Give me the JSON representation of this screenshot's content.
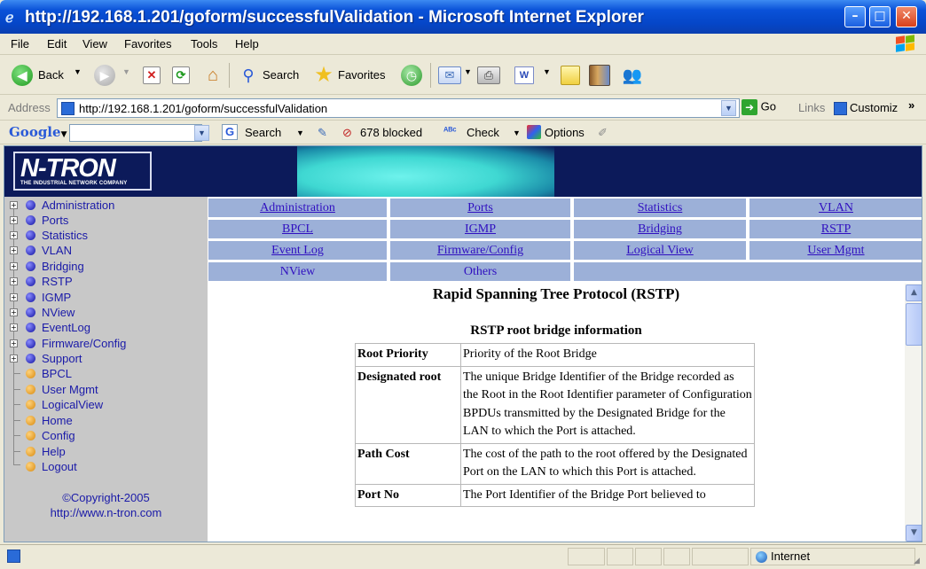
{
  "window": {
    "title": "http://192.168.1.201/goform/successfulValidation - Microsoft Internet Explorer"
  },
  "menu": [
    "File",
    "Edit",
    "View",
    "Favorites",
    "Tools",
    "Help"
  ],
  "toolbar": {
    "back_label": "Back",
    "search_label": "Search",
    "favorites_label": "Favorites"
  },
  "address": {
    "label": "Address",
    "url": "http://192.168.1.201/goform/successfulValidation",
    "go_label": "Go",
    "links_label": "Links",
    "customize_label": "Customiz"
  },
  "google_bar": {
    "logo": "Google",
    "search_label": "Search",
    "blocked_label": "678 blocked",
    "check_label": "Check",
    "options_label": "Options"
  },
  "banner": {
    "logo_text": "N-TRON",
    "logo_tagline": "THE INDUSTRIAL NETWORK COMPANY"
  },
  "left_nav": {
    "folders": [
      "Administration",
      "Ports",
      "Statistics",
      "VLAN",
      "Bridging",
      "RSTP",
      "IGMP",
      "NView",
      "EventLog",
      "Firmware/Config",
      "Support"
    ],
    "pages": [
      "BPCL",
      "User Mgmt",
      "LogicalView",
      "Home",
      "Config",
      "Help",
      "Logout"
    ],
    "copyright": "©Copyright-2005",
    "website": "http://www.n-tron.com"
  },
  "top_nav": {
    "row1": [
      "Administration",
      "Ports",
      "Statistics",
      "VLAN"
    ],
    "row2": [
      "BPCL",
      "IGMP",
      "Bridging",
      "RSTP"
    ],
    "row3": [
      "Event Log",
      "Firmware/Config",
      "Logical View",
      "User Mgmt"
    ],
    "row4": [
      "NView",
      "Others"
    ]
  },
  "main": {
    "page_title": "Rapid Spanning Tree Protocol (RSTP)",
    "section_title": "RSTP root bridge information",
    "rows": [
      {
        "key": "Root Priority",
        "value": "Priority of the Root Bridge"
      },
      {
        "key": "Designated root",
        "value": "The unique Bridge Identifier of the Bridge recorded as the Root in the Root Identifier parameter of Configuration BPDUs transmitted by the Designated Bridge for the LAN to which the Port is attached."
      },
      {
        "key": "Path Cost",
        "value": "The cost of the path to the root offered by the Designated Port on the LAN to which this Port is attached."
      },
      {
        "key": "Port No",
        "value": "The Port Identifier of the Bridge Port believed to"
      }
    ]
  },
  "status": {
    "zone": "Internet"
  },
  "colors": {
    "title_bar": "#0a52d8",
    "banner": "#0c1a5a",
    "nav_cell": "#9cb0d8",
    "link": "#3010c0",
    "tree_text": "#1a1aa8",
    "left_panel": "#c8c8c8"
  }
}
